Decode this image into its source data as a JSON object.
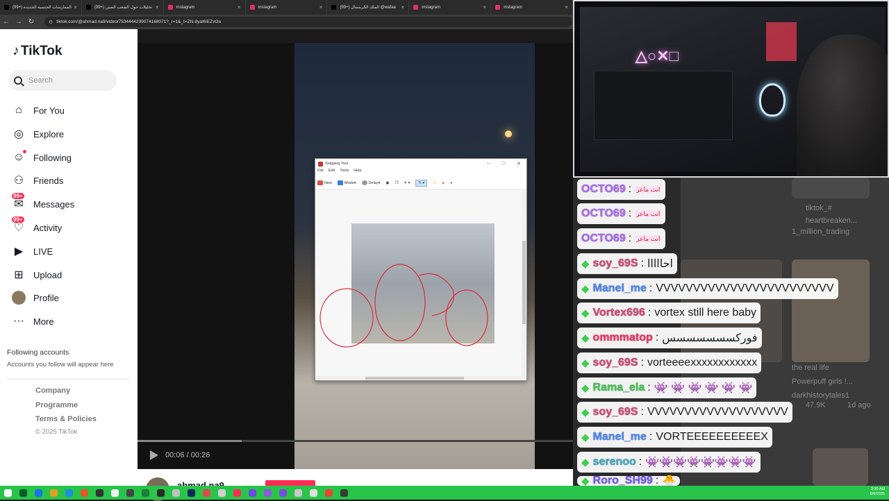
{
  "browser": {
    "tabs": [
      {
        "title": "(99+) الممارسات الجنسية الجديدة",
        "icon_color": "#000000",
        "active": false
      },
      {
        "title": "(99+) تحليلات حول الشعب الصين",
        "icon_color": "#000000",
        "active": false
      },
      {
        "title": "Instagram",
        "icon_color": "#e1306c",
        "active": false
      },
      {
        "title": "Instagram",
        "icon_color": "#e1306c",
        "active": false
      },
      {
        "title": "(99+) الملك الكريستال @wafaa",
        "icon_color": "#000000",
        "active": false
      },
      {
        "title": "Instagram",
        "icon_color": "#e1306c",
        "active": false
      },
      {
        "title": "Instagram",
        "icon_color": "#e1306c",
        "active": false
      }
    ],
    "url": "tiktok.com/@ahmad.na9/video/7534444239074168071?_r=1&_t=ZN-8yaI6iEZvOa"
  },
  "tiktok": {
    "logo_text": "TikTok",
    "search_placeholder": "Search",
    "nav": [
      {
        "label": "For You",
        "icon": "home-icon",
        "glyph": "⌂"
      },
      {
        "label": "Explore",
        "icon": "compass-icon",
        "glyph": "◎"
      },
      {
        "label": "Following",
        "icon": "following-icon",
        "glyph": "☺"
      },
      {
        "label": "Friends",
        "icon": "friends-icon",
        "glyph": "⚇"
      },
      {
        "label": "Messages",
        "icon": "messages-icon",
        "glyph": "✉",
        "badge": "99+"
      },
      {
        "label": "Activity",
        "icon": "activity-icon",
        "glyph": "♡",
        "badge": "99+"
      },
      {
        "label": "LIVE",
        "icon": "live-icon",
        "glyph": "▶"
      },
      {
        "label": "Upload",
        "icon": "upload-icon",
        "glyph": "⊞"
      },
      {
        "label": "Profile",
        "icon": "profile-avatar",
        "glyph": ""
      },
      {
        "label": "More",
        "icon": "more-icon",
        "glyph": "···"
      }
    ],
    "following_accounts_title": "Following accounts",
    "following_accounts_sub": "Accounts you follow will appear here",
    "footer_links": [
      "Company",
      "Programme",
      "Terms & Policies"
    ],
    "copyright": "© 2025 TikTok",
    "video": {
      "time": "00:06 / 00:26",
      "progress": 0.24,
      "author": "ahmad.na9"
    }
  },
  "snipping_tool": {
    "title": "Snipping Tool",
    "menu": [
      "File",
      "Edit",
      "Tools",
      "Help"
    ],
    "toolbar": [
      "New",
      "Mode",
      "Delay"
    ]
  },
  "chat": {
    "messages": [
      {
        "user": "OCTO69",
        "text": "",
        "tag": "انت ماعر",
        "user_color": "#b26bff"
      },
      {
        "user": "OCTO69",
        "text": "",
        "tag": "انت ماعر",
        "user_color": "#b26bff"
      },
      {
        "user": "OCTO69",
        "text": "",
        "tag": "انت ماعر",
        "user_color": "#b26bff"
      },
      {
        "user": "soy_69S",
        "text": "احااااا",
        "user_color": "#e0457b"
      },
      {
        "user": "Manel_me",
        "text": "VVVVVVVVVVVVVVVVVVVVVVVV",
        "user_color": "#4a8cff"
      },
      {
        "user": "Vortex696",
        "text": "vortex still here baby",
        "user_color": "#e0457b"
      },
      {
        "user": "ommmatop",
        "text": "فوركسسسسسسس",
        "user_color": "#ff2e63"
      },
      {
        "user": "soy_69S",
        "text": "vorteeeexxxxxxxxxxxx",
        "user_color": "#e0457b"
      },
      {
        "user": "Rama_ela",
        "text": "👾 👾 👾 👾 👾 👾",
        "user_color": "#3ccf4e"
      },
      {
        "user": "soy_69S",
        "text": "VVVVVVVVVVVVVVVVVVV",
        "user_color": "#e0457b"
      },
      {
        "user": "Manel_me",
        "text": "VORTEEEEEEEEEEX",
        "user_color": "#4a8cff"
      },
      {
        "user": "serenoo",
        "text": "👾👾👾👾👾👾👾👾",
        "user_color": "#39b3c9"
      },
      {
        "user": "Roro_SH99",
        "text": "🐣",
        "user_color": "#7a5cff"
      }
    ],
    "bg_texts": [
      "tiktok_#",
      "heartbreaken...",
      "1_million_trading",
      "the real life",
      "Powerpuff girls !...",
      "darkhistorytales1",
      "47.9K",
      "1d ago"
    ]
  },
  "taskbar": {
    "time": "3:30 AM",
    "date": "8/8/2025"
  }
}
